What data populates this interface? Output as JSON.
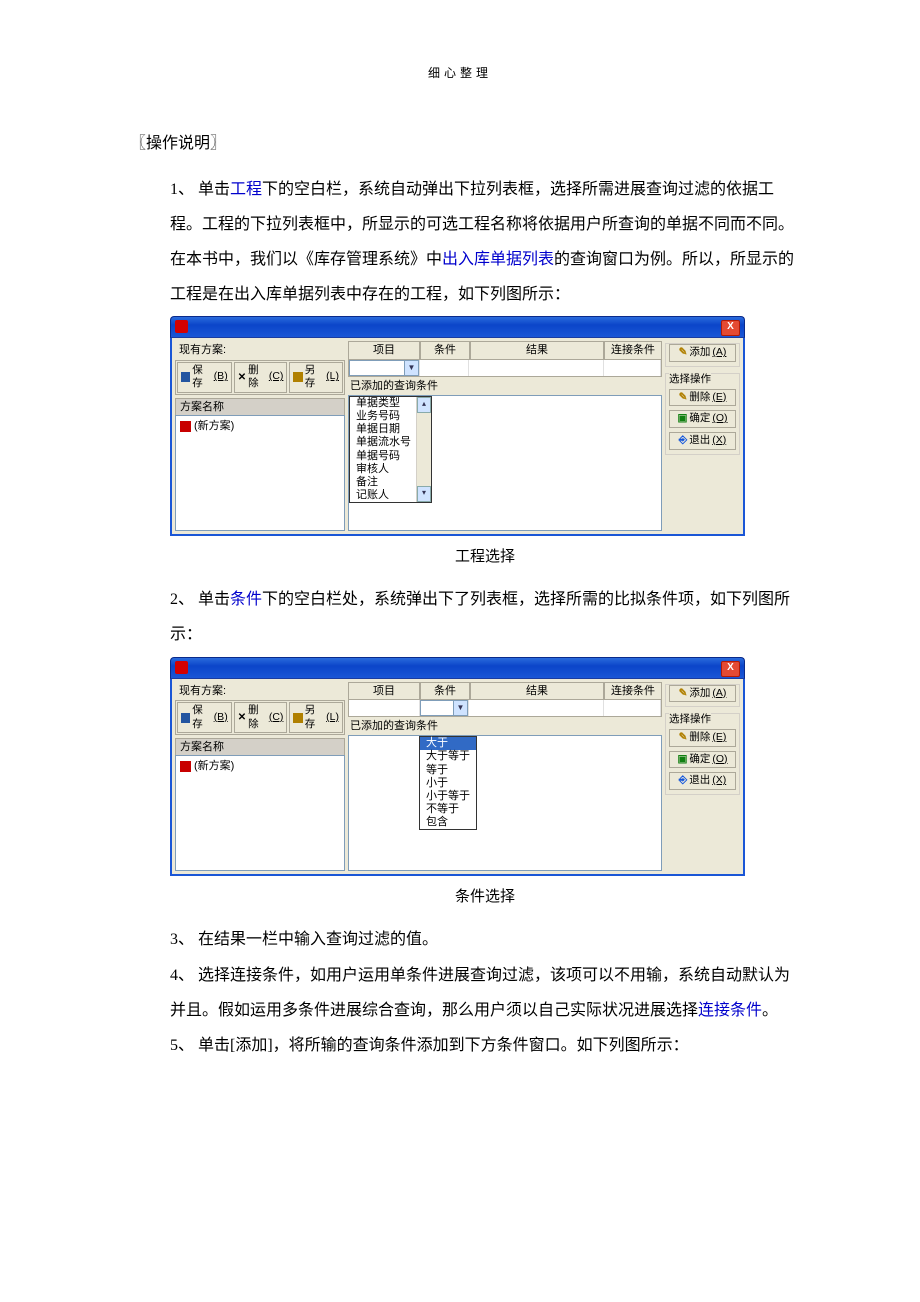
{
  "header": "细心整理",
  "section_title": "〖操作说明〗",
  "steps": {
    "s1": {
      "num": "1、",
      "t1": "单击",
      "link1": "工程",
      "t2": "下的空白栏，系统自动弹出下拉列表框，选择所需进展查询过滤的依据工程。工程的下拉列表框中，所显示的可选工程名称将依据用户所查询的单据不同而不同。在本书中，我们以《库存管理系统》中",
      "link2": "出入库单据列表",
      "t3": "的查询窗口为例。所以，所显示的工程是在出入库单据列表中存在的工程，如下列图所示："
    },
    "cap1": "工程选择",
    "s2": {
      "num": "2、",
      "t1": "单击",
      "link1": "条件",
      "t2": "下的空白栏处，系统弹出下了列表框，选择所需的比拟条件项，如下列图所示："
    },
    "cap2": "条件选择",
    "s3": {
      "num": "3、",
      "t": "在结果一栏中输入查询过滤的值。"
    },
    "s4": {
      "num": "4、",
      "t1": "选择连接条件，如用户运用单条件进展查询过滤，该项可以不用输，系统自动默认为并且。假如运用多条件进展综合查询，那么用户须以自己实际状况进展选择",
      "link1": "连接条件",
      "t2": "。"
    },
    "s5": {
      "num": "5、",
      "t": "单击[添加]，将所输的查询条件添加到下方条件窗口。如下列图所示："
    }
  },
  "dialog": {
    "close": "X",
    "cur_plan": "现有方案:",
    "save": "保存",
    "save_k": "(B)",
    "del": "删除",
    "del_k": "(C)",
    "saveas": "另存",
    "saveas_k": "(L)",
    "plan_name_hdr": "方案名称",
    "plan_item": "(新方案)",
    "col_proj": "项目",
    "col_cond": "条件",
    "col_res": "结果",
    "col_conn": "连接条件",
    "lower_label": "已添加的查询条件",
    "grp_select": "选择操作",
    "add": "添加",
    "add_k": "(A)",
    "del2": "删除",
    "del2_k": "(E)",
    "ok": "确定",
    "ok_k": "(O)",
    "exit": "退出",
    "exit_k": "(X)",
    "proj_opts": [
      "单据类型",
      "业务号码",
      "单据日期",
      "单据流水号",
      "单据号码",
      "审核人",
      "备注",
      "记账人"
    ],
    "cond_opts": [
      "大于",
      "大于等于",
      "等于",
      "小于",
      "小于等于",
      "不等于",
      "包含"
    ]
  }
}
